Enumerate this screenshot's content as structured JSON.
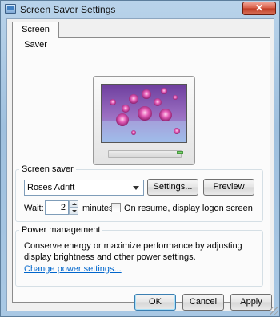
{
  "window": {
    "title": "Screen Saver Settings",
    "close_label": "✕"
  },
  "tabs": [
    {
      "label": "Screen Saver",
      "selected": true
    }
  ],
  "preview": {
    "description_icon": "monitor-icon"
  },
  "screen_saver_group": {
    "legend": "Screen saver",
    "selected_saver": "Roses Adrift",
    "settings_button": "Settings...",
    "preview_button": "Preview",
    "wait_label": "Wait:",
    "wait_value": "2",
    "minutes_label": "minutes",
    "logon_checkbox_label": "On resume, display logon screen",
    "logon_checked": false
  },
  "power_group": {
    "legend": "Power management",
    "description": "Conserve energy or maximize performance by adjusting display brightness and other power settings.",
    "link": "Change power settings..."
  },
  "footer": {
    "ok": "OK",
    "cancel": "Cancel",
    "apply": "Apply"
  },
  "colors": {
    "link": "#0066cc",
    "title_gradient_top": "#b9d3ea",
    "close_button": "#d65a43"
  }
}
